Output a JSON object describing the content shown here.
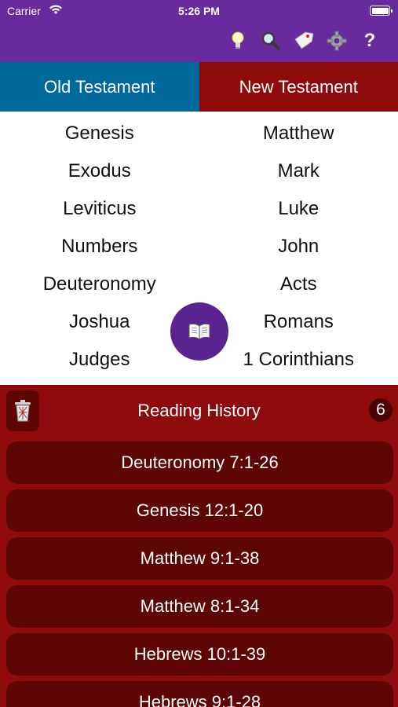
{
  "status_bar": {
    "carrier": "Carrier",
    "time": "5:26 PM"
  },
  "toolbar": {
    "icons": [
      "lightbulb-icon",
      "search-icon",
      "tag-icon",
      "gear-icon",
      "help-icon"
    ],
    "help_glyph": "?"
  },
  "tabs": {
    "old": "Old Testament",
    "new": "New Testament"
  },
  "books": {
    "old": [
      "Genesis",
      "Exodus",
      "Leviticus",
      "Numbers",
      "Deuteronomy",
      "Joshua",
      "Judges"
    ],
    "new": [
      "Matthew",
      "Mark",
      "Luke",
      "John",
      "Acts",
      "Romans",
      "1 Corinthians"
    ]
  },
  "history": {
    "title": "Reading History",
    "count": "6",
    "entries": [
      "Deuteronomy 7:1-26",
      "Genesis 12:1-20",
      "Matthew 9:1-38",
      "Matthew 8:1-34",
      "Hebrews 10:1-39",
      "Hebrews 9:1-28"
    ]
  },
  "colors": {
    "header": "#672b9e",
    "old_tab": "#00699c",
    "new_tab": "#8f0b0b",
    "history_bg": "#8f0b0b",
    "history_item": "#5e0505",
    "fab": "#5a2490"
  }
}
